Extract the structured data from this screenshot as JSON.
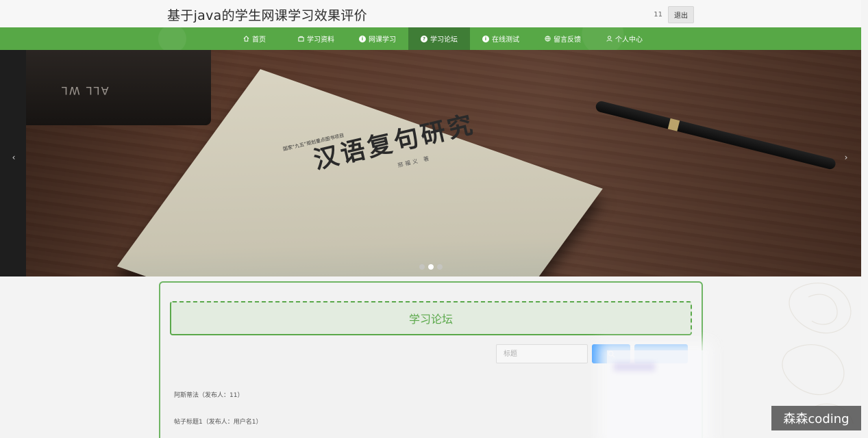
{
  "header": {
    "site_title": "基于java的学生网课学习效果评价",
    "username": "11",
    "logout_label": "退出"
  },
  "nav": {
    "items": [
      {
        "label": "首页",
        "icon": "home-icon"
      },
      {
        "label": "学习资料",
        "icon": "folder-icon"
      },
      {
        "label": "网课学习",
        "icon": "info-circle-icon"
      },
      {
        "label": "学习论坛",
        "icon": "question-circle-icon",
        "active": true
      },
      {
        "label": "在线测试",
        "icon": "info-circle-icon"
      },
      {
        "label": "留言反馈",
        "icon": "globe-icon"
      },
      {
        "label": "个人中心",
        "icon": "user-icon"
      }
    ],
    "color": "#57a846",
    "active_color": "#3f7d36"
  },
  "carousel": {
    "book_title": "汉语复句研究",
    "book_series": "国家“九五”规划重点图书项目",
    "book_author": "邢福义 著",
    "spine_text": "ALL WL",
    "prev_icon": "chevron-left-icon",
    "next_icon": "chevron-right-icon",
    "dots_count": 3,
    "active_dot": 2
  },
  "forum": {
    "title": "学习论坛",
    "search_placeholder": "标题",
    "search_icon": "search-icon",
    "posts": [
      {
        "text": "阿斯蒂法（发布人：11）"
      },
      {
        "text": "帖子标题1（发布人：用户名1）"
      }
    ]
  },
  "watermark": "森森coding",
  "colors": {
    "accent": "#5aa84a",
    "button": "#409eff"
  }
}
